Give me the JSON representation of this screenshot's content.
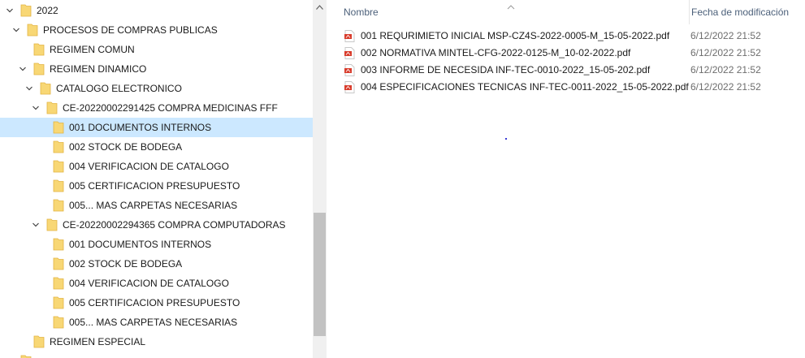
{
  "tree": {
    "items": [
      {
        "label": "2022",
        "expanded": true
      },
      {
        "label": "PROCESOS DE COMPRAS PUBLICAS",
        "expanded": true
      },
      {
        "label": "REGIMEN COMUN",
        "expanded": false
      },
      {
        "label": "REGIMEN DINAMICO",
        "expanded": true
      },
      {
        "label": "CATALOGO ELECTRONICO",
        "expanded": true
      },
      {
        "label": "CE-20220002291425 COMPRA MEDICINAS FFF",
        "expanded": true
      },
      {
        "label": "001 DOCUMENTOS INTERNOS",
        "selected": true
      },
      {
        "label": "002 STOCK DE BODEGA"
      },
      {
        "label": "004 VERIFICACION DE CATALOGO"
      },
      {
        "label": "005 CERTIFICACION PRESUPUESTO"
      },
      {
        "label": "005... MAS CARPETAS NECESARIAS"
      },
      {
        "label": "CE-20220002294365 COMPRA COMPUTADORAS",
        "expanded": true
      },
      {
        "label": "001 DOCUMENTOS INTERNOS"
      },
      {
        "label": "002 STOCK DE BODEGA"
      },
      {
        "label": "004 VERIFICACION DE CATALOGO"
      },
      {
        "label": "005 CERTIFICACION PRESUPUESTO"
      },
      {
        "label": "005... MAS CARPETAS NECESARIAS"
      },
      {
        "label": "REGIMEN ESPECIAL"
      }
    ]
  },
  "list": {
    "columns": {
      "name": "Nombre",
      "date": "Fecha de modificación"
    },
    "files": [
      {
        "name": "001 REQURIMIETO INICIAL MSP-CZ4S-2022-0005-M_15-05-2022.pdf",
        "date": "6/12/2022 21:52"
      },
      {
        "name": "002 NORMATIVA MINTEL-CFG-2022-0125-M_10-02-2022.pdf",
        "date": "6/12/2022 21:52"
      },
      {
        "name": "003 INFORME DE NECESIDA INF-TEC-0010-2022_15-05-202.pdf",
        "date": "6/12/2022 21:52"
      },
      {
        "name": "004 ESPECIFICACIONES TECNICAS INF-TEC-0011-2022_15-05-2022.pdf",
        "date": "6/12/2022 21:52"
      }
    ]
  },
  "colors": {
    "selection": "#cce8ff",
    "folder": "#f8d775",
    "header_text": "#4c607a",
    "pdf_red": "#d83b2b"
  },
  "icons": {
    "folder": "folder-icon",
    "pdf": "pdf-file-icon",
    "expand": "chevron-down-icon",
    "sort": "sort-ascending-icon"
  }
}
